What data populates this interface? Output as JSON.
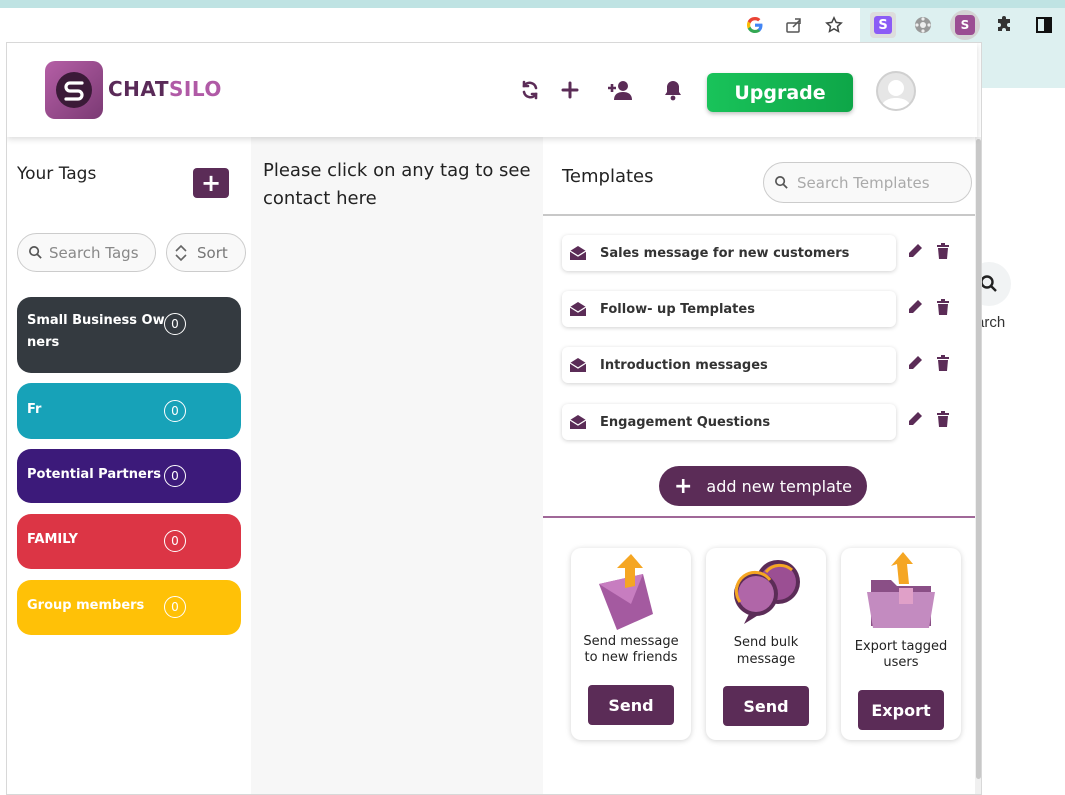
{
  "browser": {
    "extension_icons": [
      "google-icon",
      "share-icon",
      "star-icon",
      "s-extension-icon",
      "film-extension-icon",
      "chatsilo-extension-icon",
      "puzzle-icon",
      "sidepanel-icon"
    ],
    "page_search_label": "arch"
  },
  "header": {
    "logo_text_main": "CHAT",
    "logo_text_accent": "SILO",
    "upgrade_label": "Upgrade"
  },
  "tags": {
    "title": "Your Tags",
    "add_label": "+",
    "search_placeholder": "Search Tags",
    "sort_label": "Sort",
    "items": [
      {
        "label": "Small Business Ow",
        "label2": "ners",
        "count": "0",
        "color": "#343a40"
      },
      {
        "label": "Fr",
        "label2": "",
        "count": "0",
        "color": "#17a2b8"
      },
      {
        "label": "Potential Partners",
        "label2": "",
        "count": "0",
        "color": "#3c1a7a"
      },
      {
        "label": "FAMILY",
        "label2": "",
        "count": "0",
        "color": "#dc3545"
      },
      {
        "label": "Group members",
        "label2": "",
        "count": "0",
        "color": "#ffc107"
      }
    ]
  },
  "contacts": {
    "empty_message": "Please click on any tag to see contact here"
  },
  "templates": {
    "title": "Templates",
    "search_placeholder": "Search Templates",
    "items": [
      {
        "label": "Sales message for new customers"
      },
      {
        "label": "Follow- up Templates"
      },
      {
        "label": "Introduction messages"
      },
      {
        "label": "Engagement Questions"
      }
    ],
    "add_label": "add new template"
  },
  "actions": [
    {
      "text": "Send message to new friends",
      "line1": "Send message",
      "line2": "to new friends",
      "button": "Send"
    },
    {
      "text": "Send bulk message",
      "line1": "Send bulk",
      "line2": "message",
      "button": "Send"
    },
    {
      "text": "Export tagged users",
      "line1": "Export tagged",
      "line2": "users",
      "button": "Export"
    }
  ],
  "colors": {
    "brand": "#5b2c57",
    "upgrade": "#19c35a"
  }
}
